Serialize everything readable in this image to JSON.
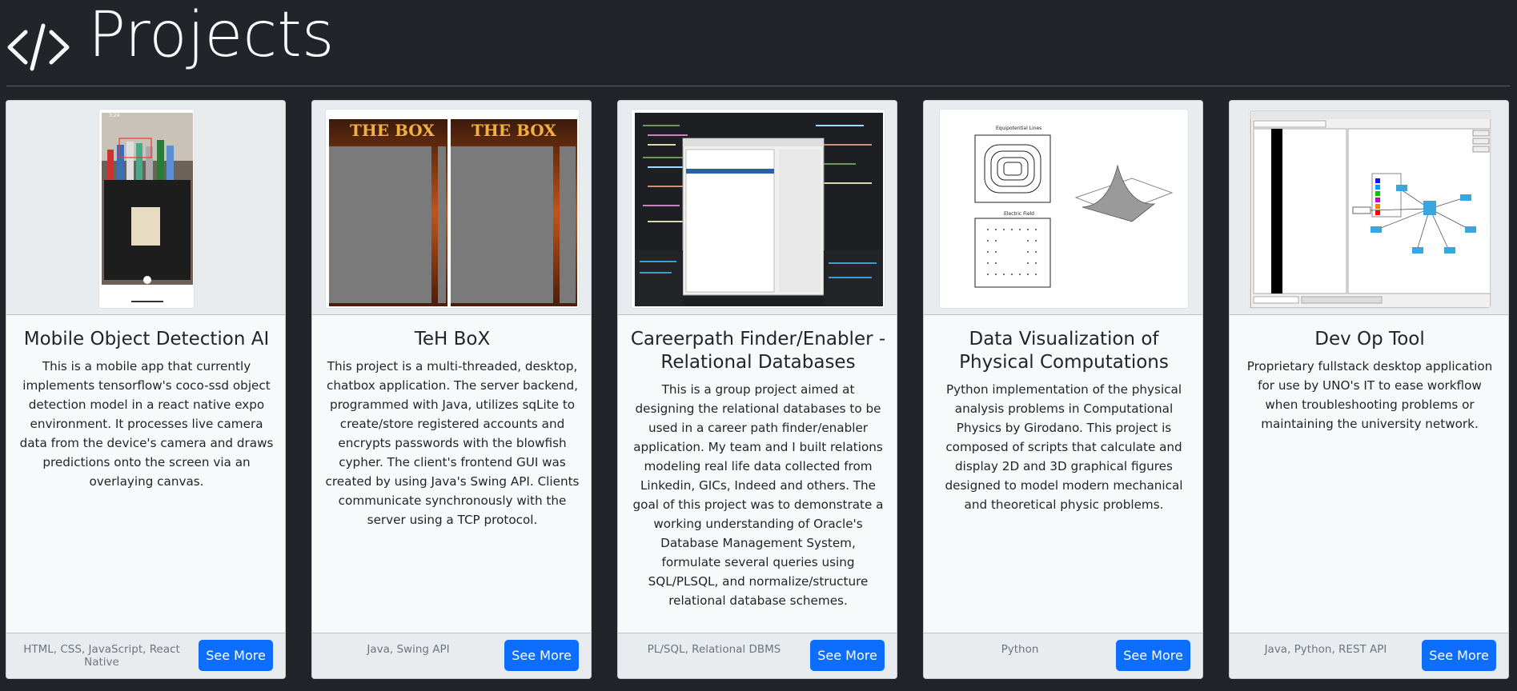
{
  "header": {
    "title": "Projects",
    "icon": "code-icon"
  },
  "cards": [
    {
      "title": "Mobile Object Detection AI",
      "text": "This is a mobile app that currently implements tensorflow's coco-ssd object detection model in a react native expo environment. It processes live camera data from the device's camera and draws predictions onto the screen via an overlaying canvas.",
      "tech": "HTML, CSS, JavaScript, React Native",
      "button": "See More",
      "thumb_time": "3:24"
    },
    {
      "title": "TeH BoX",
      "text": "This project is a multi-threaded, desktop, chatbox application. The server backend, programmed with Java, utilizes sqLite to create/store registered accounts and encrypts passwords with the blowfish cypher. The client's frontend GUI was created by using Java's Swing API. Clients communicate synchronously with the server using a TCP protocol.",
      "tech": "Java, Swing API",
      "button": "See More",
      "thumb_label": "THE BOX"
    },
    {
      "title": "Careerpath Finder/Enabler - Relational Databases",
      "text": "This is a group project aimed at designing the relational databases to be used in a career path finder/enabler application. My team and I built relations modeling real life data collected from Linkedin, GICs, Indeed and others. The goal of this project was to demonstrate a working understanding of Oracle's Database Management System, formulate several queries using SQL/PLSQL, and normalize/structure relational database schemes.",
      "tech": "PL/SQL, Relational DBMS",
      "button": "See More"
    },
    {
      "title": "Data Visualization of Physical Computations",
      "text": "Python implementation of the physical analysis problems in Computational Physics by Girodano. This project is composed of scripts that calculate and display 2D and 3D graphical figures designed to model modern mechanical and theoretical physic problems.",
      "tech": "Python",
      "button": "See More",
      "thumb_top_title": "Equipotential Lines",
      "thumb_bottom_title": "Electric Field"
    },
    {
      "title": "Dev Op Tool",
      "text": "Proprietary fullstack desktop application for use by UNO's IT to ease workflow when troubleshooting problems or maintaining the university network.",
      "tech": "Java, Python, REST API",
      "button": "See More"
    }
  ]
}
